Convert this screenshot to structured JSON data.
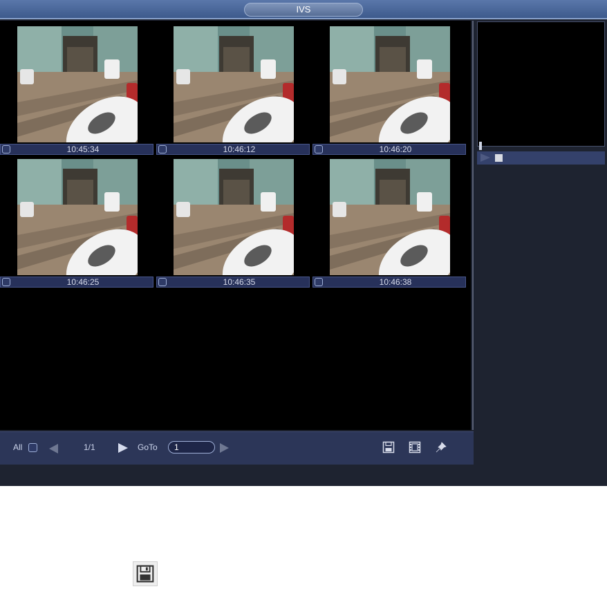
{
  "window": {
    "title": "IVS"
  },
  "snapshots": [
    {
      "time": "10:45:34"
    },
    {
      "time": "10:46:12"
    },
    {
      "time": "10:46:20"
    },
    {
      "time": "10:46:25"
    },
    {
      "time": "10:46:35"
    },
    {
      "time": "10:46:38"
    }
  ],
  "toolbar": {
    "all_label": "All",
    "page_indicator": "1/1",
    "goto_label": "GoTo",
    "goto_value": "1",
    "icons": [
      "save-icon",
      "video-backup-icon",
      "lock-pin-icon"
    ]
  },
  "colors": {
    "titlebar": "#4a669a",
    "panel": "#1e2330",
    "caption_bar": "#27315a",
    "toolbar": "#2c3658"
  }
}
